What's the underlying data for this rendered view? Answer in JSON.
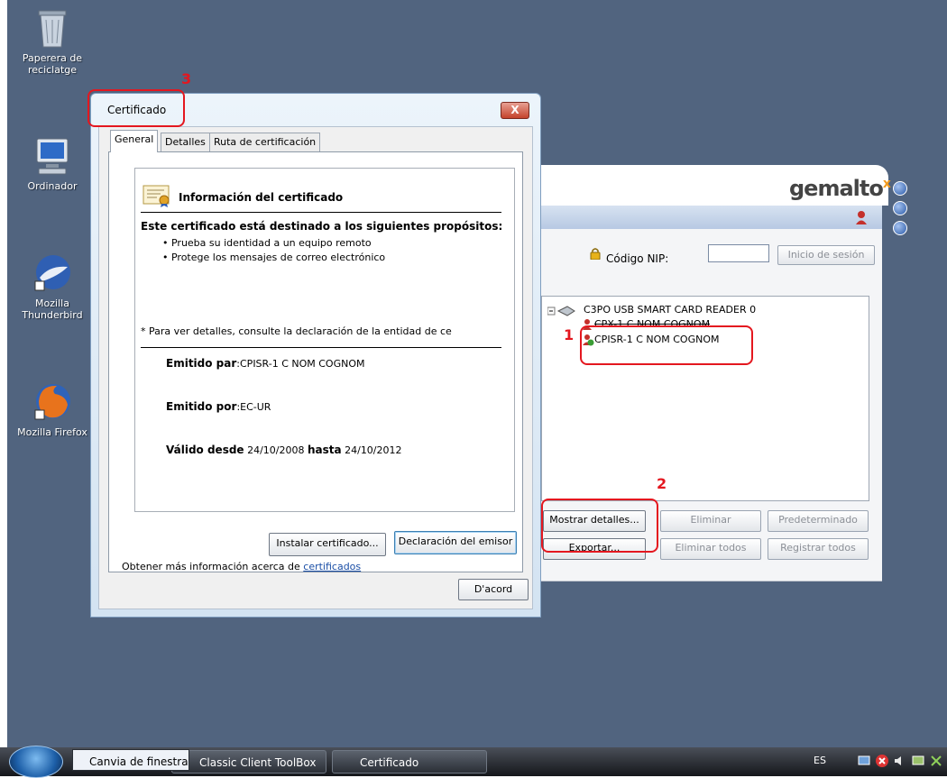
{
  "desktop": {
    "icons": [
      {
        "label": "Paperera de\nreciclatge",
        "icon": "recycle-bin-icon"
      },
      {
        "label": "Ordinador",
        "icon": "computer-icon"
      },
      {
        "label": "Mozilla\nThunderbird",
        "icon": "thunderbird-icon"
      },
      {
        "label": "Mozilla Firefox",
        "icon": "firefox-icon"
      }
    ]
  },
  "gemalto": {
    "logo": "gemalto",
    "logo_mark": "x",
    "nip_label": "Código NIP:",
    "login_button": "Inicio de sesión",
    "tree": {
      "reader": "C3PO USB SMART CARD READER 0",
      "cert1": "CPX-1 C NOM COGNOM",
      "cert2": "CPISR-1 C NOM COGNOM"
    },
    "buttons": {
      "show_details": "Mostrar detalles...",
      "delete": "Eliminar",
      "default": "Predeterminado",
      "export": "Exportar...",
      "delete_all": "Eliminar todos",
      "register_all": "Registrar todos"
    }
  },
  "cert_dialog": {
    "title": "Certificado",
    "close_label": "X",
    "tabs": [
      "General",
      "Detalles",
      "Ruta de certificación"
    ],
    "info_title": "Información del certificado",
    "purpose_heading": "Este certificado está destinado a los siguientes propósitos:",
    "purposes": [
      "• Prueba su identidad a un equipo remoto",
      "• Protege los mensajes de correo electrónico"
    ],
    "note": "* Para ver detalles, consulte la declaración de la entidad de ce",
    "issued_to_label": "Emitido par",
    "issued_to_value": "CPISR-1 C NOM COGNOM",
    "issued_by_label": "Emitido por",
    "issued_by_value": "EC-UR",
    "valid_from_label": "Válido desde",
    "valid_from_value": "24/10/2008",
    "valid_to_label": "hasta",
    "valid_to_value": "24/10/2012",
    "install_button": "Instalar certificado...",
    "issuer_statement_button": "Declaración del emisor",
    "more_info_text": "Obtener más información acerca de",
    "more_info_link": "certificados",
    "ok_button": "D'acord"
  },
  "annotations": [
    "1",
    "2",
    "3"
  ],
  "taskbar": {
    "tooltip": "Canvia de finestra",
    "items": [
      "Classic Client ToolBox",
      "Certificado"
    ],
    "language": "ES"
  },
  "colors": {
    "desktop": "#51647f",
    "annotation": "#e4171f",
    "link": "#1a4ea6"
  }
}
